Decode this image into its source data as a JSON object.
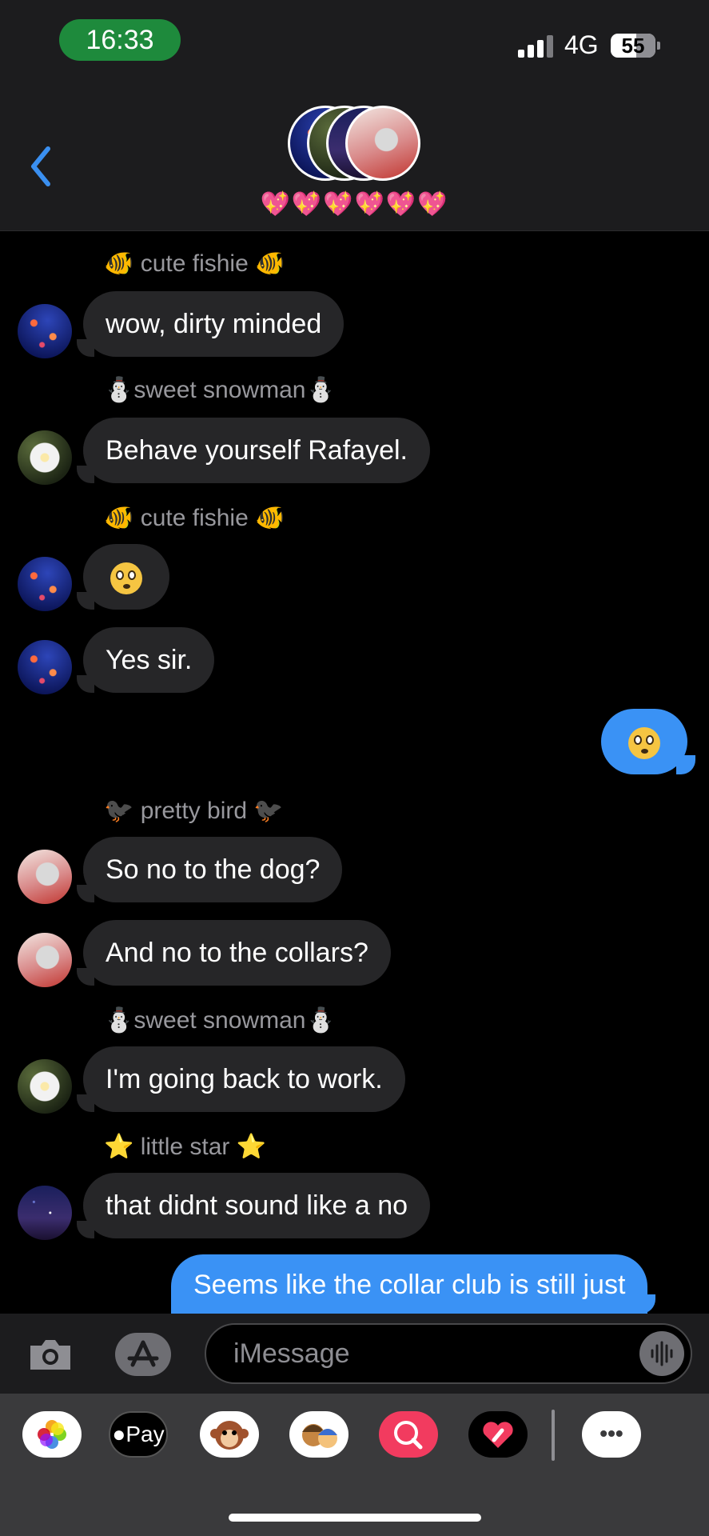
{
  "status": {
    "time": "16:33",
    "network": "4G",
    "battery": "55"
  },
  "header": {
    "group_name": "💖💖💖💖💖💖"
  },
  "messages": [
    {
      "sender": "🐠 cute fishie 🐠"
    },
    {
      "text": "wow, dirty minded"
    },
    {
      "sender": "⛄sweet snowman⛄"
    },
    {
      "text": "Behave yourself Rafayel."
    },
    {
      "sender": "🐠 cute fishie 🐠"
    },
    {
      "text": "😳"
    },
    {
      "text": "Yes sir."
    },
    {
      "text": "😳"
    },
    {
      "sender": "🐦‍⬛ pretty bird 🐦‍⬛"
    },
    {
      "text": "So no to the dog?"
    },
    {
      "text": "And no to the collars?"
    },
    {
      "sender": "⛄sweet snowman⛄"
    },
    {
      "text": "I'm going back to work."
    },
    {
      "sender": "⭐ little star ⭐"
    },
    {
      "text": "that didnt sound like a no"
    },
    {
      "text": "Seems like the collar club is still just"
    }
  ],
  "composer": {
    "placeholder": "iMessage"
  },
  "apps": {
    "pay_label": "Pay",
    "more_label": "•••"
  },
  "colors": {
    "incoming": "#262628",
    "outgoing": "#3a92f5",
    "accent": "#3a8ff0"
  }
}
